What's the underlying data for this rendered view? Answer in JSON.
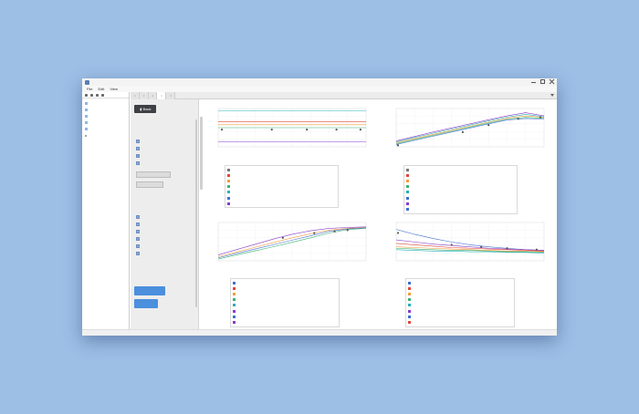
{
  "window": {
    "menu": [
      "File",
      "Edit",
      "View"
    ]
  },
  "tree": {
    "items": [
      "",
      "",
      "",
      "",
      "",
      ""
    ]
  },
  "tabs": [
    "",
    "",
    "",
    "",
    ""
  ],
  "sidepanel": {
    "back_label": "Back",
    "section1": "",
    "checkboxes1": [
      "",
      "",
      "",
      ""
    ],
    "btn1": "",
    "btn2": "",
    "section2": "",
    "checkboxes2": [
      "",
      "",
      "",
      "",
      "",
      ""
    ],
    "section3": "",
    "action1": "",
    "action2": ""
  },
  "status": "",
  "colors": {
    "accent": "#4b8fdd",
    "orange": "#f39c3c",
    "green": "#3cb371",
    "blue": "#3f6fd1",
    "purple": "#8a3cc8",
    "teal": "#2ab0b8",
    "red": "#e0473c",
    "gray": "#777777"
  },
  "chart_data": [
    {
      "type": "line",
      "title": "",
      "xlabel": "",
      "ylabel": "",
      "x": [
        0,
        1,
        2,
        3,
        4,
        5,
        6,
        7,
        8
      ],
      "series": [
        {
          "values": [
            1.25,
            1.25,
            1.25,
            1.25,
            1.25,
            1.25,
            1.25,
            1.25,
            1.25
          ],
          "color": "teal"
        },
        {
          "values": [
            1.02,
            1.02,
            1.02,
            1.02,
            1.02,
            1.02,
            1.02,
            1.02,
            1.02
          ],
          "color": "red"
        },
        {
          "values": [
            0.96,
            0.96,
            0.96,
            0.96,
            0.96,
            0.96,
            0.96,
            0.96,
            0.96
          ],
          "color": "orange"
        },
        {
          "values": [
            0.9,
            0.9,
            0.9,
            0.9,
            0.9,
            0.9,
            0.9,
            0.9,
            0.9
          ],
          "color": "green"
        },
        {
          "values": [
            0.6,
            0.6,
            0.6,
            0.6,
            0.6,
            0.6,
            0.6,
            0.6,
            0.6
          ],
          "color": "purple"
        }
      ],
      "points": [
        [
          0.2,
          0.86
        ],
        [
          2.9,
          0.86
        ],
        [
          4.8,
          0.86
        ],
        [
          6.4,
          0.86
        ],
        [
          7.7,
          0.86
        ]
      ],
      "ylim": [
        0.5,
        1.3
      ],
      "legend": [
        "",
        "",
        "",
        "",
        "",
        "",
        ""
      ],
      "legend_colors": [
        "gray",
        "red",
        "orange",
        "green",
        "teal",
        "blue",
        "purple"
      ]
    },
    {
      "type": "line",
      "title": "",
      "xlabel": "",
      "ylabel": "",
      "x": [
        0,
        1,
        2,
        3,
        4,
        5,
        6,
        7,
        8
      ],
      "series": [
        {
          "values": [
            0.2,
            0.35,
            0.5,
            0.64,
            0.78,
            0.92,
            1.05,
            1.16,
            1.05
          ],
          "color": "purple"
        },
        {
          "values": [
            0.17,
            0.32,
            0.46,
            0.6,
            0.74,
            0.88,
            1.01,
            1.1,
            1.02
          ],
          "color": "teal"
        },
        {
          "values": [
            0.14,
            0.28,
            0.42,
            0.56,
            0.7,
            0.84,
            0.97,
            1.05,
            1.0
          ],
          "color": "orange"
        },
        {
          "values": [
            0.11,
            0.25,
            0.39,
            0.53,
            0.67,
            0.81,
            0.94,
            1.0,
            0.97
          ],
          "color": "green"
        },
        {
          "values": [
            0.08,
            0.22,
            0.36,
            0.5,
            0.64,
            0.78,
            0.91,
            0.96,
            0.94
          ],
          "color": "blue"
        }
      ],
      "points": [
        [
          0.1,
          0.05
        ],
        [
          3.6,
          0.5
        ],
        [
          5.0,
          0.74
        ],
        [
          6.6,
          0.95
        ],
        [
          7.8,
          1.0
        ]
      ],
      "ylim": [
        0,
        1.3
      ],
      "legend": [
        "",
        "",
        "",
        "",
        "",
        "",
        "",
        ""
      ],
      "legend_colors": [
        "gray",
        "red",
        "orange",
        "green",
        "teal",
        "blue",
        "purple",
        "blue"
      ]
    },
    {
      "type": "line",
      "title": "",
      "xlabel": "",
      "ylabel": "",
      "x": [
        0,
        1,
        2,
        3,
        4,
        5,
        6,
        7,
        8
      ],
      "series": [
        {
          "values": [
            0.1,
            0.28,
            0.46,
            0.64,
            0.8,
            0.92,
            1.0,
            1.03,
            1.05
          ],
          "color": "purple"
        },
        {
          "values": [
            0.04,
            0.2,
            0.36,
            0.52,
            0.68,
            0.82,
            0.94,
            1.0,
            1.03
          ],
          "color": "orange"
        },
        {
          "values": [
            0.0,
            0.15,
            0.3,
            0.45,
            0.6,
            0.75,
            0.9,
            0.98,
            1.02
          ],
          "color": "blue"
        },
        {
          "values": [
            -0.04,
            0.1,
            0.24,
            0.38,
            0.53,
            0.68,
            0.84,
            0.96,
            1.0
          ],
          "color": "green"
        }
      ],
      "points": [
        [
          3.5,
          0.68
        ],
        [
          5.2,
          0.84
        ],
        [
          6.3,
          0.9
        ],
        [
          7.0,
          0.94
        ]
      ],
      "ylim": [
        -0.1,
        1.2
      ],
      "legend": [
        "",
        "",
        "",
        "",
        "",
        "",
        "",
        ""
      ],
      "legend_colors": [
        "blue",
        "red",
        "orange",
        "green",
        "teal",
        "purple",
        "blue",
        "purple"
      ]
    },
    {
      "type": "line",
      "title": "",
      "xlabel": "",
      "ylabel": "",
      "x": [
        0,
        1,
        2,
        3,
        4,
        5,
        6,
        7,
        8
      ],
      "series": [
        {
          "values": [
            1.05,
            0.98,
            0.92,
            0.87,
            0.83,
            0.8,
            0.78,
            0.76,
            0.75
          ],
          "color": "blue"
        },
        {
          "values": [
            0.9,
            0.87,
            0.84,
            0.82,
            0.8,
            0.78,
            0.77,
            0.76,
            0.75
          ],
          "color": "purple"
        },
        {
          "values": [
            0.85,
            0.83,
            0.81,
            0.79,
            0.78,
            0.77,
            0.76,
            0.75,
            0.74
          ],
          "color": "red"
        },
        {
          "values": [
            0.8,
            0.79,
            0.78,
            0.77,
            0.76,
            0.75,
            0.74,
            0.74,
            0.73
          ],
          "color": "orange"
        },
        {
          "values": [
            0.78,
            0.77,
            0.76,
            0.75,
            0.75,
            0.74,
            0.73,
            0.73,
            0.72
          ],
          "color": "green"
        },
        {
          "values": [
            0.76,
            0.75,
            0.74,
            0.74,
            0.73,
            0.73,
            0.72,
            0.72,
            0.71
          ],
          "color": "teal"
        }
      ],
      "points": [
        [
          0.1,
          1.0
        ],
        [
          3.0,
          0.83
        ],
        [
          4.6,
          0.8
        ],
        [
          6.0,
          0.78
        ],
        [
          7.6,
          0.76
        ]
      ],
      "ylim": [
        0.6,
        1.15
      ],
      "legend": [
        "",
        "",
        "",
        "",
        "",
        "",
        "",
        ""
      ],
      "legend_colors": [
        "blue",
        "red",
        "orange",
        "green",
        "teal",
        "purple",
        "blue",
        "red"
      ]
    }
  ]
}
